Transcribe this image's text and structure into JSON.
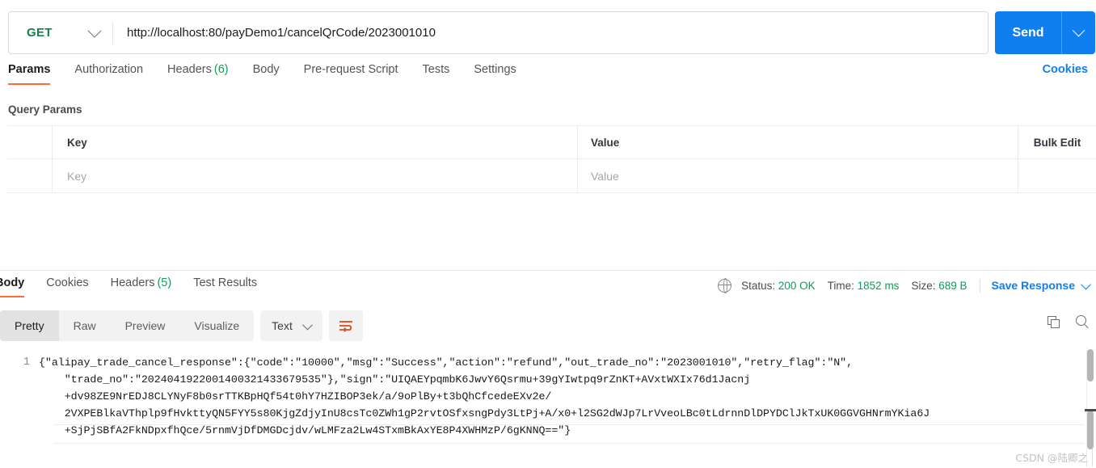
{
  "request": {
    "method": "GET",
    "url": "http://localhost:80/payDemo1/cancelQrCode/2023001010",
    "send_label": "Send",
    "tabs": [
      {
        "label": "Params",
        "count": "",
        "active": true
      },
      {
        "label": "Authorization",
        "count": "",
        "active": false
      },
      {
        "label": "Headers",
        "count": "(6)",
        "active": false
      },
      {
        "label": "Body",
        "count": "",
        "active": false
      },
      {
        "label": "Pre-request Script",
        "count": "",
        "active": false
      },
      {
        "label": "Tests",
        "count": "",
        "active": false
      },
      {
        "label": "Settings",
        "count": "",
        "active": false
      }
    ],
    "cookies_link": "Cookies"
  },
  "query_params": {
    "title": "Query Params",
    "headers": {
      "key": "Key",
      "value": "Value",
      "bulk_edit": "Bulk Edit"
    },
    "row": {
      "key_placeholder": "Key",
      "value_placeholder": "Value"
    }
  },
  "response": {
    "tabs": [
      {
        "label": "Body",
        "count": "",
        "active": true
      },
      {
        "label": "Cookies",
        "count": "",
        "active": false
      },
      {
        "label": "Headers",
        "count": "(5)",
        "active": false
      },
      {
        "label": "Test Results",
        "count": "",
        "active": false
      }
    ],
    "status": {
      "status_label": "Status:",
      "status_value": "200 OK",
      "time_label": "Time:",
      "time_value": "1852 ms",
      "size_label": "Size:",
      "size_value": "689 B",
      "save_response": "Save Response"
    },
    "view_modes": [
      {
        "label": "Pretty",
        "active": true
      },
      {
        "label": "Raw",
        "active": false
      },
      {
        "label": "Preview",
        "active": false
      },
      {
        "label": "Visualize",
        "active": false
      }
    ],
    "format": "Text",
    "line_number": "1",
    "body_lines": [
      "{\"alipay_trade_cancel_response\":{\"code\":\"10000\",\"msg\":\"Success\",\"action\":\"refund\",\"out_trade_no\":\"2023001010\",\"retry_flag\":\"N\",",
      "    \"trade_no\":\"2024041922001400321433679535\"},\"sign\":\"UIQAEYpqmbK6JwvY6Qsrmu+39gYIwtpq9rZnKT+AVxtWXIx76d1Jacnj",
      "    +dv98ZE9NrEDJ8CLYNyF8b0srTTKBpHQf54t0hY7HZIBOP3ek/a/9oPlBy+t3bQhCfcedeEXv2e/",
      "    2VXPEBlkaVThplp9fHvkttyQN5FYY5s80KjgZdjyInU8csTc0ZWh1gP2rvtOSfxsngPdy3LtPj+A/x0+l2SG2dWJp7LrVveoLBc0tLdrnnDlDPYDClJkTxUK0GGVGHNrmYKia6J",
      "    +SjPjSBfA2FkNDpxfhQce/5rnmVjDfDMGDcjdv/wLMFza2Lw4STxmBkAxYE8P4XWHMzP/6gKNNQ==\"}"
    ]
  },
  "watermark": "CSDN @陆卿之",
  "colors": {
    "accent": "#ff6c37",
    "primary": "#0f7ef1",
    "success": "#0f9d58",
    "method": "#14804a"
  }
}
